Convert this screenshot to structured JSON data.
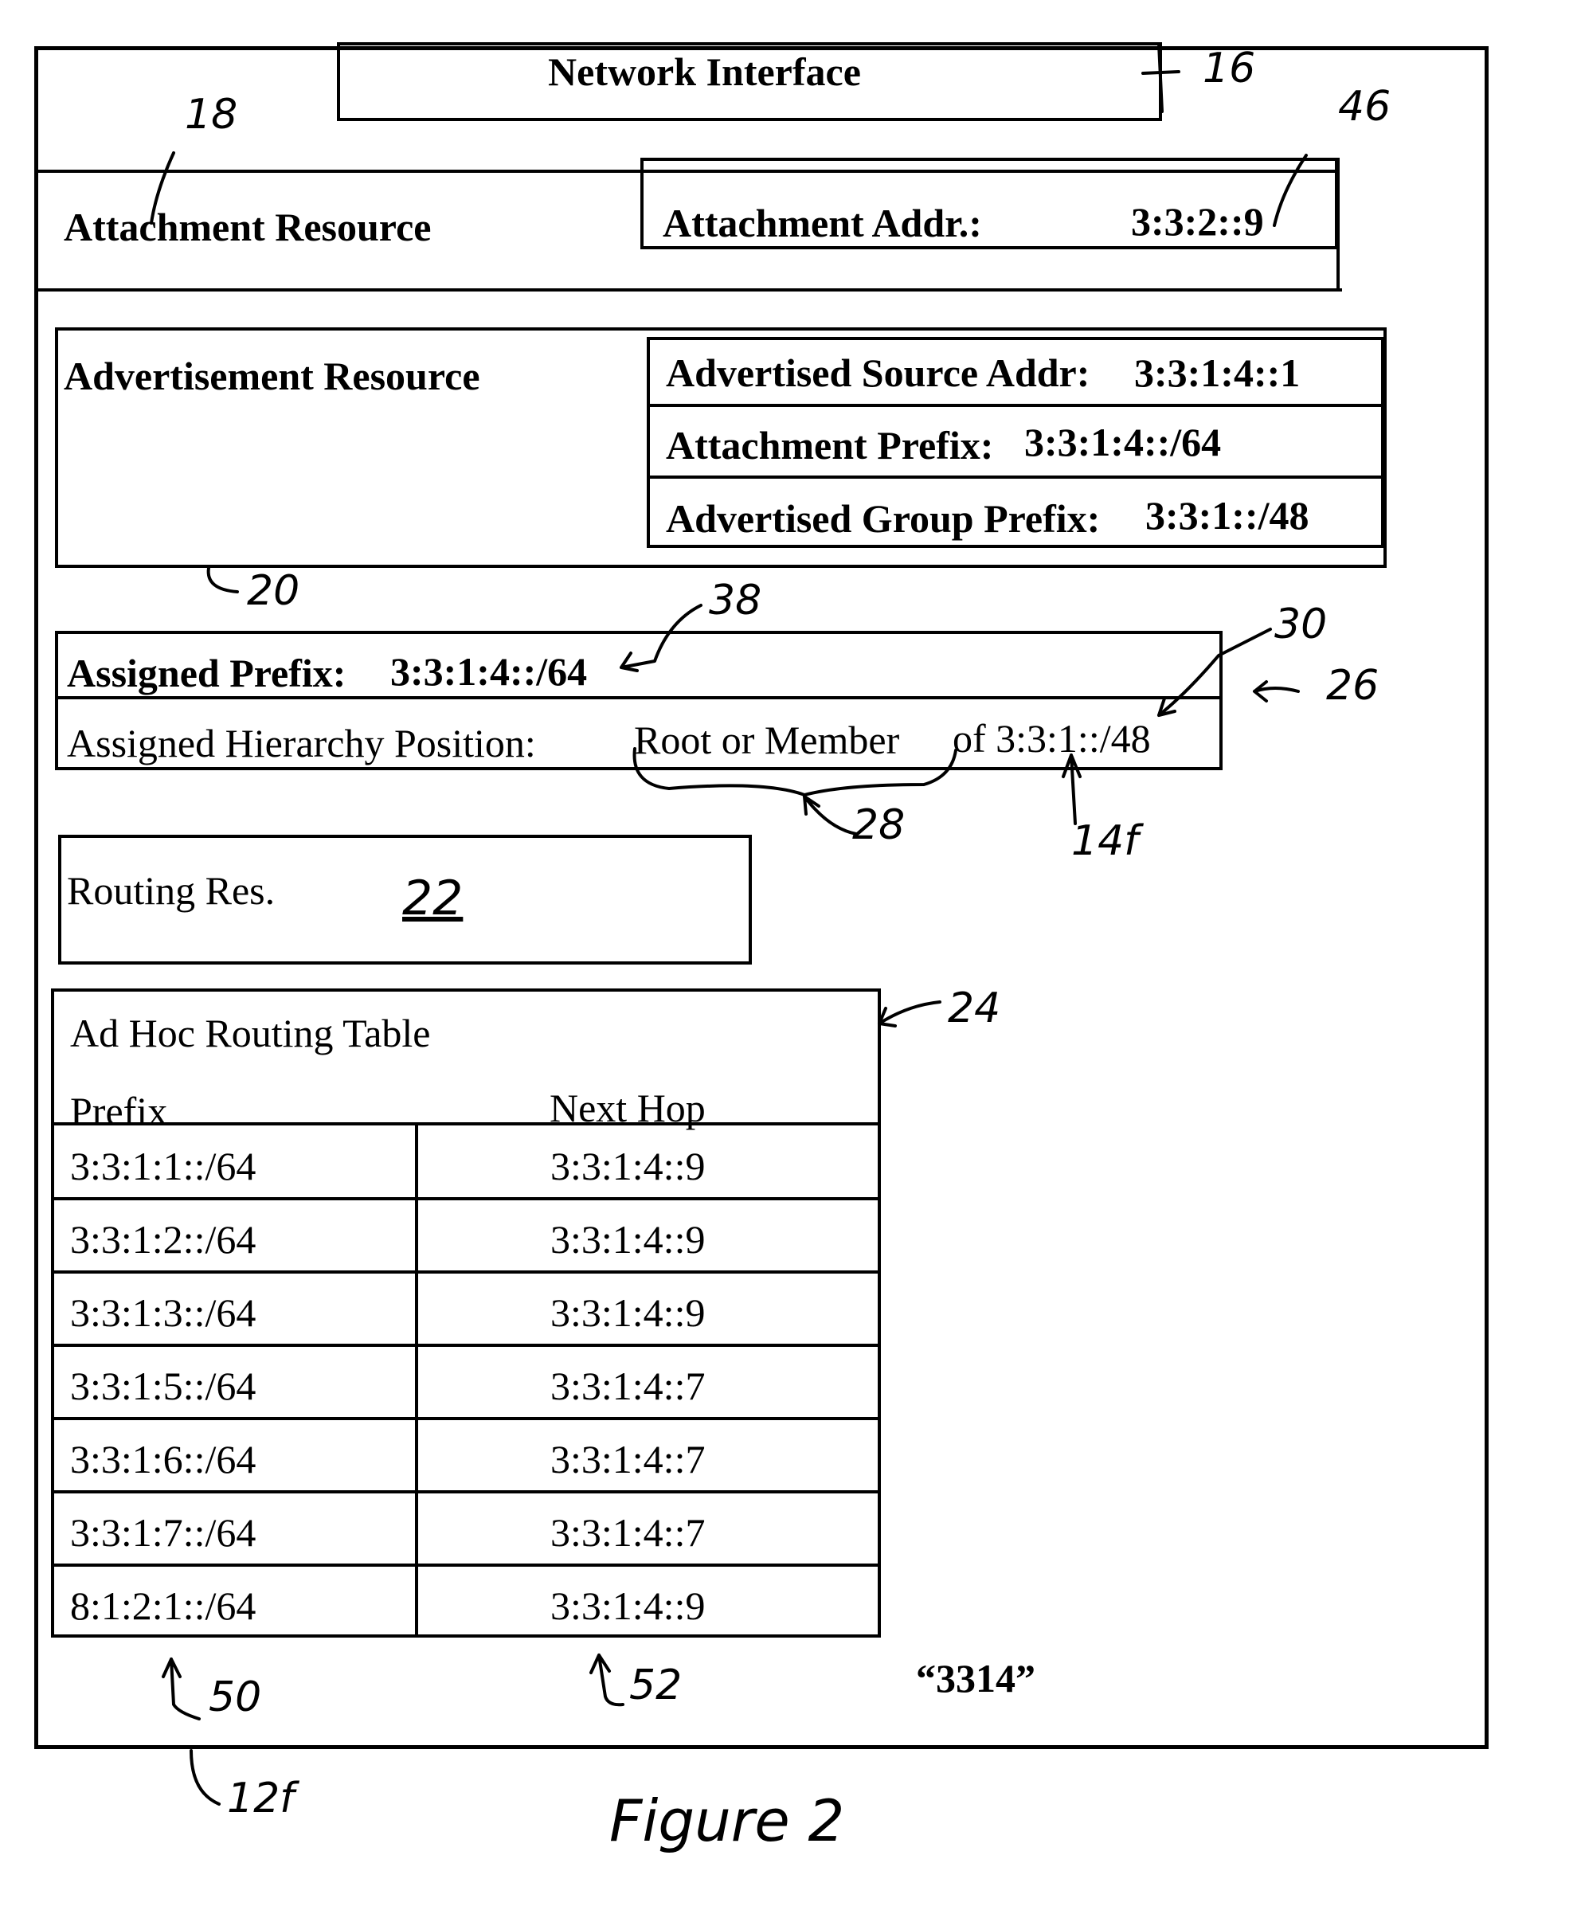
{
  "figure": {
    "caption": "Figure 2",
    "device_ref": "12f",
    "footer_label": "“3314”"
  },
  "network_interface": {
    "label": "Network Interface",
    "ref": "16"
  },
  "attachment_resource": {
    "label": "Attachment Resource",
    "ref": "18",
    "address_label": "Attachment Addr.:",
    "address_value": "3:3:2::9",
    "address_ref": "46"
  },
  "advertisement_resource": {
    "label": "Advertisement Resource",
    "ref": "20",
    "fields": [
      {
        "label": "Advertised Source Addr:",
        "value": "3:3:1:4::1"
      },
      {
        "label": "Attachment Prefix:",
        "value": "3:3:1:4::/64"
      },
      {
        "label": "Advertised Group Prefix:",
        "value": "3:3:1::/48"
      }
    ]
  },
  "assignment": {
    "ref": "26",
    "prefix_label": "Assigned Prefix:",
    "prefix_value": "3:3:1:4::/64",
    "prefix_ref": "38",
    "hierarchy_label": "Assigned Hierarchy Position:",
    "hierarchy_value": "Root or Member",
    "hierarchy_of": "of 3:3:1::/48",
    "hierarchy_ref": "28",
    "group_prefix_ref": "30",
    "group_id_ref": "14f"
  },
  "routing_resource": {
    "label": "Routing Res.",
    "ref": "22"
  },
  "routing_table": {
    "title": "Ad Hoc Routing Table",
    "ref": "24",
    "columns": [
      "Prefix",
      "Next Hop"
    ],
    "prefix_col_ref": "50",
    "next_hop_col_ref": "52",
    "rows": [
      {
        "prefix": "3:3:1:1::/64",
        "next_hop": "3:3:1:4::9"
      },
      {
        "prefix": "3:3:1:2::/64",
        "next_hop": "3:3:1:4::9"
      },
      {
        "prefix": "3:3:1:3::/64",
        "next_hop": "3:3:1:4::9"
      },
      {
        "prefix": "3:3:1:5::/64",
        "next_hop": "3:3:1:4::7"
      },
      {
        "prefix": "3:3:1:6::/64",
        "next_hop": "3:3:1:4::7"
      },
      {
        "prefix": "3:3:1:7::/64",
        "next_hop": "3:3:1:4::7"
      },
      {
        "prefix": "8:1:2:1::/64",
        "next_hop": "3:3:1:4::9"
      }
    ]
  }
}
